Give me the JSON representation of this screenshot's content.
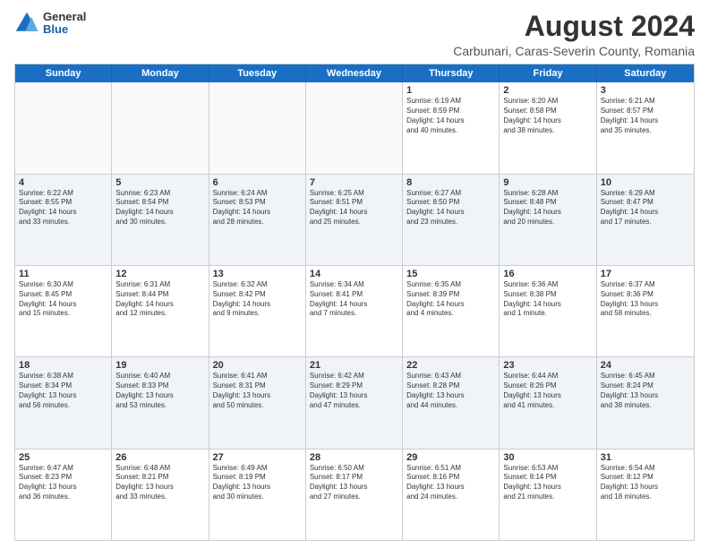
{
  "logo": {
    "general": "General",
    "blue": "Blue"
  },
  "title": "August 2024",
  "subtitle": "Carbunari, Caras-Severin County, Romania",
  "days": [
    "Sunday",
    "Monday",
    "Tuesday",
    "Wednesday",
    "Thursday",
    "Friday",
    "Saturday"
  ],
  "rows": [
    [
      {
        "day": "",
        "lines": []
      },
      {
        "day": "",
        "lines": []
      },
      {
        "day": "",
        "lines": []
      },
      {
        "day": "",
        "lines": []
      },
      {
        "day": "1",
        "lines": [
          "Sunrise: 6:19 AM",
          "Sunset: 8:59 PM",
          "Daylight: 14 hours",
          "and 40 minutes."
        ]
      },
      {
        "day": "2",
        "lines": [
          "Sunrise: 6:20 AM",
          "Sunset: 8:58 PM",
          "Daylight: 14 hours",
          "and 38 minutes."
        ]
      },
      {
        "day": "3",
        "lines": [
          "Sunrise: 6:21 AM",
          "Sunset: 8:57 PM",
          "Daylight: 14 hours",
          "and 35 minutes."
        ]
      }
    ],
    [
      {
        "day": "4",
        "lines": [
          "Sunrise: 6:22 AM",
          "Sunset: 8:55 PM",
          "Daylight: 14 hours",
          "and 33 minutes."
        ]
      },
      {
        "day": "5",
        "lines": [
          "Sunrise: 6:23 AM",
          "Sunset: 8:54 PM",
          "Daylight: 14 hours",
          "and 30 minutes."
        ]
      },
      {
        "day": "6",
        "lines": [
          "Sunrise: 6:24 AM",
          "Sunset: 8:53 PM",
          "Daylight: 14 hours",
          "and 28 minutes."
        ]
      },
      {
        "day": "7",
        "lines": [
          "Sunrise: 6:25 AM",
          "Sunset: 8:51 PM",
          "Daylight: 14 hours",
          "and 25 minutes."
        ]
      },
      {
        "day": "8",
        "lines": [
          "Sunrise: 6:27 AM",
          "Sunset: 8:50 PM",
          "Daylight: 14 hours",
          "and 23 minutes."
        ]
      },
      {
        "day": "9",
        "lines": [
          "Sunrise: 6:28 AM",
          "Sunset: 8:48 PM",
          "Daylight: 14 hours",
          "and 20 minutes."
        ]
      },
      {
        "day": "10",
        "lines": [
          "Sunrise: 6:29 AM",
          "Sunset: 8:47 PM",
          "Daylight: 14 hours",
          "and 17 minutes."
        ]
      }
    ],
    [
      {
        "day": "11",
        "lines": [
          "Sunrise: 6:30 AM",
          "Sunset: 8:45 PM",
          "Daylight: 14 hours",
          "and 15 minutes."
        ]
      },
      {
        "day": "12",
        "lines": [
          "Sunrise: 6:31 AM",
          "Sunset: 8:44 PM",
          "Daylight: 14 hours",
          "and 12 minutes."
        ]
      },
      {
        "day": "13",
        "lines": [
          "Sunrise: 6:32 AM",
          "Sunset: 8:42 PM",
          "Daylight: 14 hours",
          "and 9 minutes."
        ]
      },
      {
        "day": "14",
        "lines": [
          "Sunrise: 6:34 AM",
          "Sunset: 8:41 PM",
          "Daylight: 14 hours",
          "and 7 minutes."
        ]
      },
      {
        "day": "15",
        "lines": [
          "Sunrise: 6:35 AM",
          "Sunset: 8:39 PM",
          "Daylight: 14 hours",
          "and 4 minutes."
        ]
      },
      {
        "day": "16",
        "lines": [
          "Sunrise: 6:36 AM",
          "Sunset: 8:38 PM",
          "Daylight: 14 hours",
          "and 1 minute."
        ]
      },
      {
        "day": "17",
        "lines": [
          "Sunrise: 6:37 AM",
          "Sunset: 8:36 PM",
          "Daylight: 13 hours",
          "and 58 minutes."
        ]
      }
    ],
    [
      {
        "day": "18",
        "lines": [
          "Sunrise: 6:38 AM",
          "Sunset: 8:34 PM",
          "Daylight: 13 hours",
          "and 56 minutes."
        ]
      },
      {
        "day": "19",
        "lines": [
          "Sunrise: 6:40 AM",
          "Sunset: 8:33 PM",
          "Daylight: 13 hours",
          "and 53 minutes."
        ]
      },
      {
        "day": "20",
        "lines": [
          "Sunrise: 6:41 AM",
          "Sunset: 8:31 PM",
          "Daylight: 13 hours",
          "and 50 minutes."
        ]
      },
      {
        "day": "21",
        "lines": [
          "Sunrise: 6:42 AM",
          "Sunset: 8:29 PM",
          "Daylight: 13 hours",
          "and 47 minutes."
        ]
      },
      {
        "day": "22",
        "lines": [
          "Sunrise: 6:43 AM",
          "Sunset: 8:28 PM",
          "Daylight: 13 hours",
          "and 44 minutes."
        ]
      },
      {
        "day": "23",
        "lines": [
          "Sunrise: 6:44 AM",
          "Sunset: 8:26 PM",
          "Daylight: 13 hours",
          "and 41 minutes."
        ]
      },
      {
        "day": "24",
        "lines": [
          "Sunrise: 6:45 AM",
          "Sunset: 8:24 PM",
          "Daylight: 13 hours",
          "and 38 minutes."
        ]
      }
    ],
    [
      {
        "day": "25",
        "lines": [
          "Sunrise: 6:47 AM",
          "Sunset: 8:23 PM",
          "Daylight: 13 hours",
          "and 36 minutes."
        ]
      },
      {
        "day": "26",
        "lines": [
          "Sunrise: 6:48 AM",
          "Sunset: 8:21 PM",
          "Daylight: 13 hours",
          "and 33 minutes."
        ]
      },
      {
        "day": "27",
        "lines": [
          "Sunrise: 6:49 AM",
          "Sunset: 8:19 PM",
          "Daylight: 13 hours",
          "and 30 minutes."
        ]
      },
      {
        "day": "28",
        "lines": [
          "Sunrise: 6:50 AM",
          "Sunset: 8:17 PM",
          "Daylight: 13 hours",
          "and 27 minutes."
        ]
      },
      {
        "day": "29",
        "lines": [
          "Sunrise: 6:51 AM",
          "Sunset: 8:16 PM",
          "Daylight: 13 hours",
          "and 24 minutes."
        ]
      },
      {
        "day": "30",
        "lines": [
          "Sunrise: 6:53 AM",
          "Sunset: 8:14 PM",
          "Daylight: 13 hours",
          "and 21 minutes."
        ]
      },
      {
        "day": "31",
        "lines": [
          "Sunrise: 6:54 AM",
          "Sunset: 8:12 PM",
          "Daylight: 13 hours",
          "and 18 minutes."
        ]
      }
    ]
  ]
}
